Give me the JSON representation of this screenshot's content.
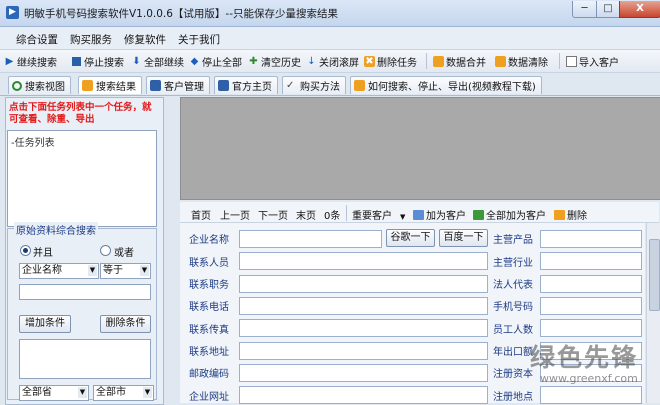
{
  "window": {
    "title": "明敏手机号码搜索软件V1.0.0.6【试用版】--只能保存少量搜索结果",
    "min_label": "─",
    "max_label": "□",
    "close_label": "X"
  },
  "menu": [
    "综合设置",
    "购买服务",
    "修复软件",
    "关于我们"
  ],
  "toolbar": {
    "continue_search": "继续搜索",
    "stop_search": "停止搜索",
    "continue_all": "全部继续",
    "stop_all": "停止全部",
    "clear_history": "清空历史",
    "close_scroll": "关闭滚屏",
    "delete_task": "删除任务",
    "merge_data": "数据合并",
    "clean_data": "数据清除",
    "import_customers": "导入客户"
  },
  "tabs": [
    "搜索视图",
    "搜索结果",
    "客户管理",
    "官方主页",
    "购买方法",
    "如何搜索、停止、导出(视频教程下载)"
  ],
  "left": {
    "hint": "点击下面任务列表中一个任务，就可查看、除重、导出",
    "task_list_root": "-任务列表",
    "filter_legend": "原始资料综合搜索",
    "radio_and": "并且",
    "radio_or": "或者",
    "field_select": "企业名称",
    "op_select": "等于",
    "add_condition": "增加条件",
    "delete_condition": "删除条件",
    "province_select": "全部省",
    "city_select": "全部市"
  },
  "actions": {
    "first": "首页",
    "prev": "上一页",
    "next": "下一页",
    "last": "末页",
    "count": "0条",
    "important": "重要客户",
    "add_customer": "加为客户",
    "add_all": "全部加为客户",
    "delete": "删除"
  },
  "form": {
    "left_labels": [
      "企业名称",
      "联系人员",
      "联系职务",
      "联系电话",
      "联系传真",
      "联系地址",
      "邮政编码",
      "企业网址"
    ],
    "right_labels": [
      "主营产品",
      "主营行业",
      "法人代表",
      "手机号码",
      "员工人数",
      "年出口额",
      "注册资本",
      "注册地点"
    ],
    "google_btn": "谷歌一下",
    "baidu_btn": "百度一下"
  },
  "watermark": {
    "text": "绿色先锋",
    "url": "www.greenxf.com"
  }
}
